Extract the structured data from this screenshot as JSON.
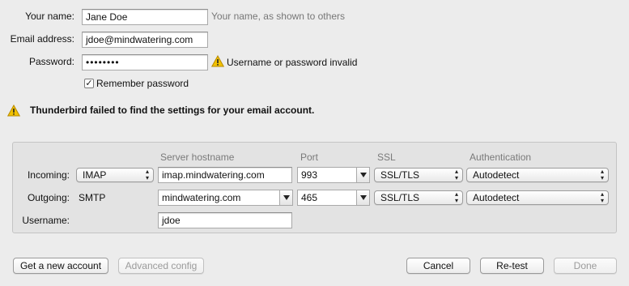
{
  "identity": {
    "name_label": "Your name:",
    "name_value": "Jane Doe",
    "name_hint": "Your name, as shown to others",
    "email_label": "Email address:",
    "email_value": "jdoe@mindwatering.com",
    "password_label": "Password:",
    "password_value": "••••••••",
    "password_error": "Username or password invalid",
    "remember_label": "Remember password",
    "remember_checked": true
  },
  "status": {
    "message": "Thunderbird failed to find the settings for your email account."
  },
  "server": {
    "headers": {
      "hostname": "Server hostname",
      "port": "Port",
      "ssl": "SSL",
      "auth": "Authentication"
    },
    "incoming": {
      "label": "Incoming:",
      "protocol": "IMAP",
      "hostname": "imap.mindwatering.com",
      "port": "993",
      "ssl": "SSL/TLS",
      "auth": "Autodetect"
    },
    "outgoing": {
      "label": "Outgoing:",
      "protocol": "SMTP",
      "hostname": "mindwatering.com",
      "port": "465",
      "ssl": "SSL/TLS",
      "auth": "Autodetect"
    },
    "username": {
      "label": "Username:",
      "value": "jdoe"
    }
  },
  "buttons": {
    "new_account": "Get a new account",
    "advanced": "Advanced config",
    "cancel": "Cancel",
    "retest": "Re-test",
    "done": "Done"
  }
}
